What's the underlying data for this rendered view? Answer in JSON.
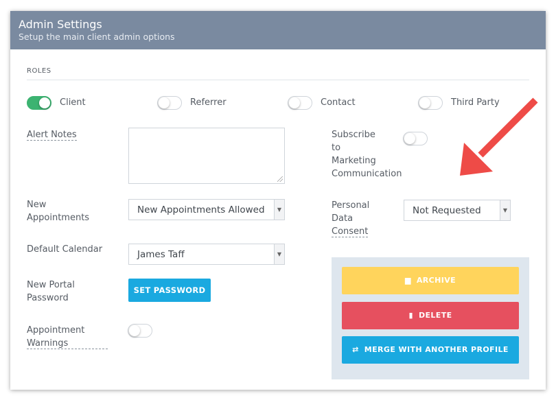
{
  "header": {
    "title": "Admin Settings",
    "subtitle": "Setup the main client admin options"
  },
  "roles": {
    "section_label": "ROLES",
    "items": [
      {
        "label": "Client",
        "enabled": true
      },
      {
        "label": "Referrer",
        "enabled": false
      },
      {
        "label": "Contact",
        "enabled": false
      },
      {
        "label": "Third Party",
        "enabled": false
      }
    ]
  },
  "alert_notes": {
    "label": "Alert Notes",
    "value": ""
  },
  "new_appointments": {
    "label_line1": "New",
    "label_line2": "Appointments",
    "selected": "New Appointments Allowed"
  },
  "default_calendar": {
    "label": "Default Calendar",
    "selected": "James Taff"
  },
  "portal_password": {
    "label_line1": "New Portal",
    "label_line2": "Password",
    "button_label": "SET PASSWORD"
  },
  "appointment_warnings": {
    "label_line1": "Appointment",
    "label_line2": "Warnings",
    "enabled": false
  },
  "subscribe_marketing": {
    "label_line1": "Subscribe",
    "label_line2": "to",
    "label_line3": "Marketing",
    "label_line4": "Communication",
    "enabled": false
  },
  "data_consent": {
    "label_line1": "Personal",
    "label_line2": "Data",
    "label_line3": "Consent",
    "selected": "Not Requested"
  },
  "actions": {
    "archive_label": "ARCHIVE",
    "delete_label": "DELETE",
    "merge_label": "MERGE WITH ANOTHER PROFILE"
  },
  "colors": {
    "header_bg": "#7a8aa0",
    "toggle_on": "#3cb371",
    "primary": "#1aa9e0",
    "archive": "#ffd45c",
    "delete": "#e6505f",
    "arrow": "#ee4b47"
  }
}
